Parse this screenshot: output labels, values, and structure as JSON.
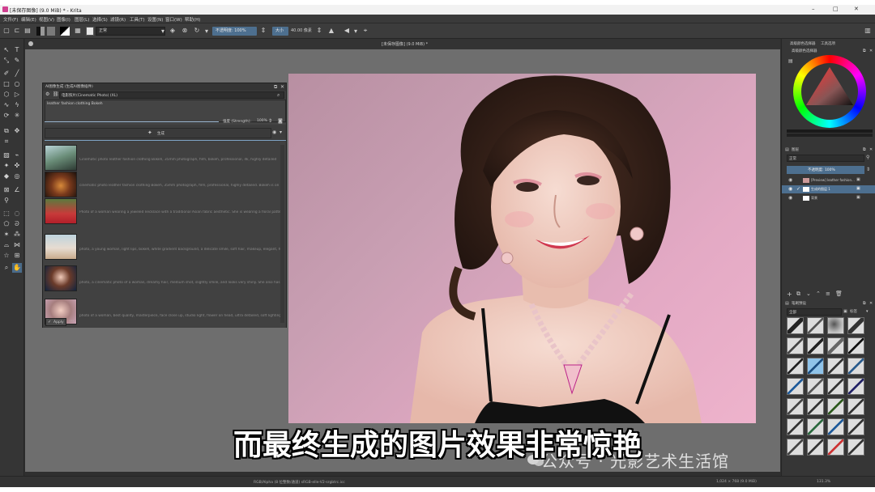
{
  "window": {
    "title": "[未保存图像] (9.0 MiB) * - Krita",
    "controls": [
      "–",
      "□",
      "✕"
    ]
  },
  "menu": [
    "文件(F)",
    "编辑(E)",
    "视图(V)",
    "图像(I)",
    "图层(L)",
    "选择(S)",
    "滤镜(R)",
    "工具(T)",
    "设置(N)",
    "窗口(W)",
    "帮助(H)"
  ],
  "toolbar": {
    "blend_mode": "正常",
    "opacity_label": "不透明度: 100%",
    "size_label": "大小",
    "size_value": "40.00 像素"
  },
  "canvas_tab": "[未保存图像] (9.0 MiB) *",
  "docker": {
    "title": "AI图像生成 (生成AI图像插件)",
    "style_select": "电影照片(Cinematic Photo) (XL)",
    "prompt": "leather fashion clothing Bokeh",
    "strength_label": "强度 (Strength):",
    "strength_value": "100%",
    "generate_label": "生成",
    "apply_label": "Apply",
    "history": [
      "Cinematic photo leather fashion clothing Bokeh, 35mm photograph, film, bokeh, professional, 4k, highly detailed",
      "cinematic photo leather fashion clothing Bokeh, 35mm photograph, film, professional, highly detailed. Bokeh is on gold",
      "Photo of a woman wearing a jeweled necklace with a traditional Asian fabric aesthetic. She is wearing a floral patterned top",
      "photo, a young woman, light lips, bokeh, white gradient background, a delicate smile, soft hair, makeup, elegant, happy",
      "photo, a cinematic photo of a woman, dreamy hair, medium shot, slightly smile, and looks very shiny. She also has a smooth",
      "photo of a woman, best quality, masterpiece, face close up, studio light, flower on head, ultra detailed, soft lighting, pink"
    ]
  },
  "right": {
    "top_tabs": [
      "高级颜色选择器",
      "工具选项"
    ],
    "color_panel": "高级颜色选择器",
    "layers_panel": "图层",
    "layers_blend": "正常",
    "layers_opacity": "不透明度: 100%",
    "layers": [
      {
        "name": "[Preview] leather fashion..."
      },
      {
        "name": "生成的图层 1"
      },
      {
        "name": "背景"
      }
    ],
    "brush_panel": "笔刷预设",
    "brush_filter": "全部",
    "brush_tag": "标签"
  },
  "status": {
    "color_space": "RGB/Alpha (8 位整数/通道)  sRGB-elle-V2-srgbtrc.icc",
    "dims": "1,024 × 768 (9.0 MiB)",
    "zoom": "131.3%"
  },
  "subtitle": "而最终生成的图片效果非常惊艳",
  "watermark": "公众号 · 光影艺术生活馆"
}
